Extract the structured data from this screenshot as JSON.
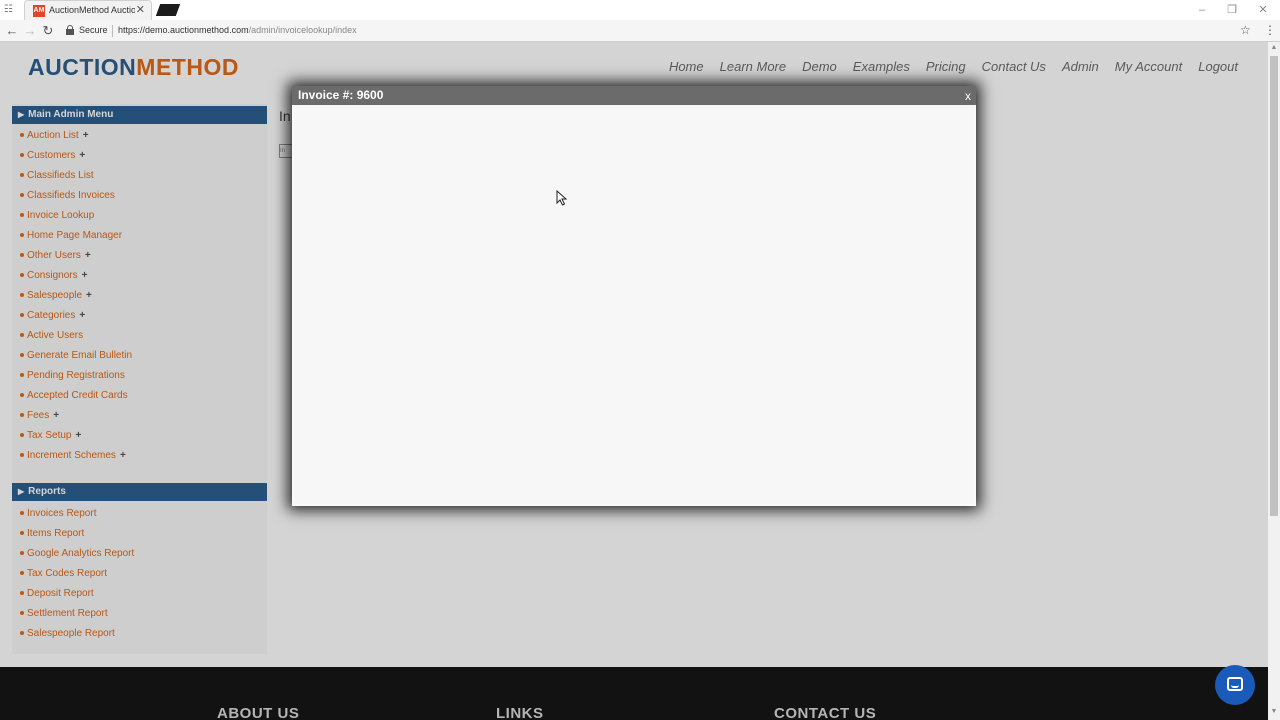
{
  "browser": {
    "tab_title": "AuctionMethod Auction",
    "favicon_text": "AM",
    "secure_label": "Secure",
    "url_host": "https://demo.auctionmethod.com",
    "url_path": "/admin/invoicelookup/index"
  },
  "site": {
    "logo_part1": "AUCTION",
    "logo_part2": "METHOD",
    "nav": [
      "Home",
      "Learn More",
      "Demo",
      "Examples",
      "Pricing",
      "Contact Us",
      "Admin",
      "My Account",
      "Logout"
    ]
  },
  "sidebar": {
    "main_menu_title": "Main Admin Menu",
    "main_menu_items": [
      {
        "label": "Auction List",
        "expandable": true
      },
      {
        "label": "Customers",
        "expandable": true
      },
      {
        "label": "Classifieds List",
        "expandable": false
      },
      {
        "label": "Classifieds Invoices",
        "expandable": false
      },
      {
        "label": "Invoice Lookup",
        "expandable": false
      },
      {
        "label": "Home Page Manager",
        "expandable": false
      },
      {
        "label": "Other Users",
        "expandable": true
      },
      {
        "label": "Consignors",
        "expandable": true
      },
      {
        "label": "Salespeople",
        "expandable": true
      },
      {
        "label": "Categories",
        "expandable": true
      },
      {
        "label": "Active Users",
        "expandable": false
      },
      {
        "label": "Generate Email Bulletin",
        "expandable": false
      },
      {
        "label": "Pending Registrations",
        "expandable": false
      },
      {
        "label": "Accepted Credit Cards",
        "expandable": false
      },
      {
        "label": "Fees",
        "expandable": true
      },
      {
        "label": "Tax Setup",
        "expandable": true
      },
      {
        "label": "Increment Schemes",
        "expandable": true
      }
    ],
    "reports_title": "Reports",
    "reports_items": [
      "Invoices Report",
      "Items Report",
      "Google Analytics Report",
      "Tax Codes Report",
      "Deposit Report",
      "Settlement Report",
      "Salespeople Report"
    ]
  },
  "content": {
    "title_partial": "In",
    "box_text": "In"
  },
  "footer": {
    "about": "ABOUT US",
    "links": "LINKS",
    "contact": "CONTACT US"
  },
  "modal": {
    "title": "Invoice #: 9600",
    "close_label": "x"
  },
  "colors": {
    "brand_blue": "#2b5f92",
    "brand_orange": "#e06a1a",
    "chat_blue": "#1a5ab8"
  }
}
